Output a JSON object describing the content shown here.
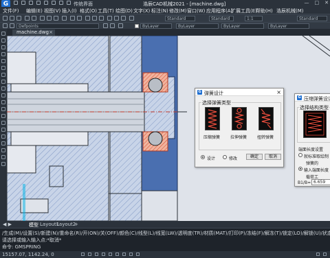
{
  "app": {
    "logo": "G",
    "workspace": "传统界面",
    "title": "浩辰CAD机械2021 - [machine.dwg]",
    "window_controls": [
      "—",
      "□",
      "✕"
    ]
  },
  "menu": [
    "文件(F)",
    "编辑(E)",
    "视图(V)",
    "插入(I)",
    "格式(O)",
    "工具(T)",
    "绘图(D)",
    "文字(X)",
    "标注(N)",
    "修改(M)",
    "窗口(W)",
    "应用程序(A)",
    "扩展工具(E)",
    "帮助(H)",
    "浩辰机械(M)"
  ],
  "toolbar": {
    "style_dropdown": "Standard",
    "layer_dropdown": "Defpoints",
    "bylayer_1": "ByLayer",
    "bylayer_2": "ByLayer",
    "bylayer_3": "ByLayer",
    "bylayer_4": "ByLayer",
    "scale_value": "1:1",
    "standard_right": "Standard",
    "color_white": "#ffffff"
  },
  "document_tab": {
    "label": "machine.dwg",
    "close": "×"
  },
  "layout_tabs": {
    "model": "模型",
    "layout1": "Layout1",
    "layout2": "Layout2",
    "add": "+"
  },
  "command": {
    "line1": "/生成(M)/设置(S)/新建(N)/重命名(R)/开(ON)/关(OFF)/颜色(C)/线型(L)/线宽(LW)/透明度(TR)/材质(MAT)/打印(P)/冻结(F)/解冻(T)/锁定(LO)/解锁(U)/状态(A)",
    "line2": "请选择或输入输入点:*取消*",
    "line3": "命令: GMSPRING"
  },
  "status": {
    "coords": "15157.07, 1142.24, 0"
  },
  "dialog_spring": {
    "title": "弹簧设计",
    "group_label": "选择弹簧类型",
    "types": [
      "压缩弹簧",
      "拉伸弹簧",
      "扭转弹簧"
    ],
    "radio_design": "设计",
    "radio_modify": "修改",
    "ok": "确定",
    "cancel": "取消",
    "close": "×"
  },
  "dialog_compress": {
    "title": "压缩弹簧设计",
    "group_label": "选择结构类型",
    "option_label": "端面长度设置",
    "radio_1": "就标准取绘制",
    "radio_2": "输入端面长度",
    "spring_label": "弹簧的",
    "work_label": "载荷工",
    "b1_label": "B1/B=",
    "b1_value": "6.659"
  },
  "colors": {
    "accent": "#1f6fd1",
    "blue_part": "#4a6fb0",
    "hatch": "#a9bbd9",
    "red": "#d9462e",
    "cyan": "#00b3e6"
  },
  "icons": [
    "app-logo-icon",
    "close-icon",
    "spring-icon",
    "radio-icon"
  ]
}
